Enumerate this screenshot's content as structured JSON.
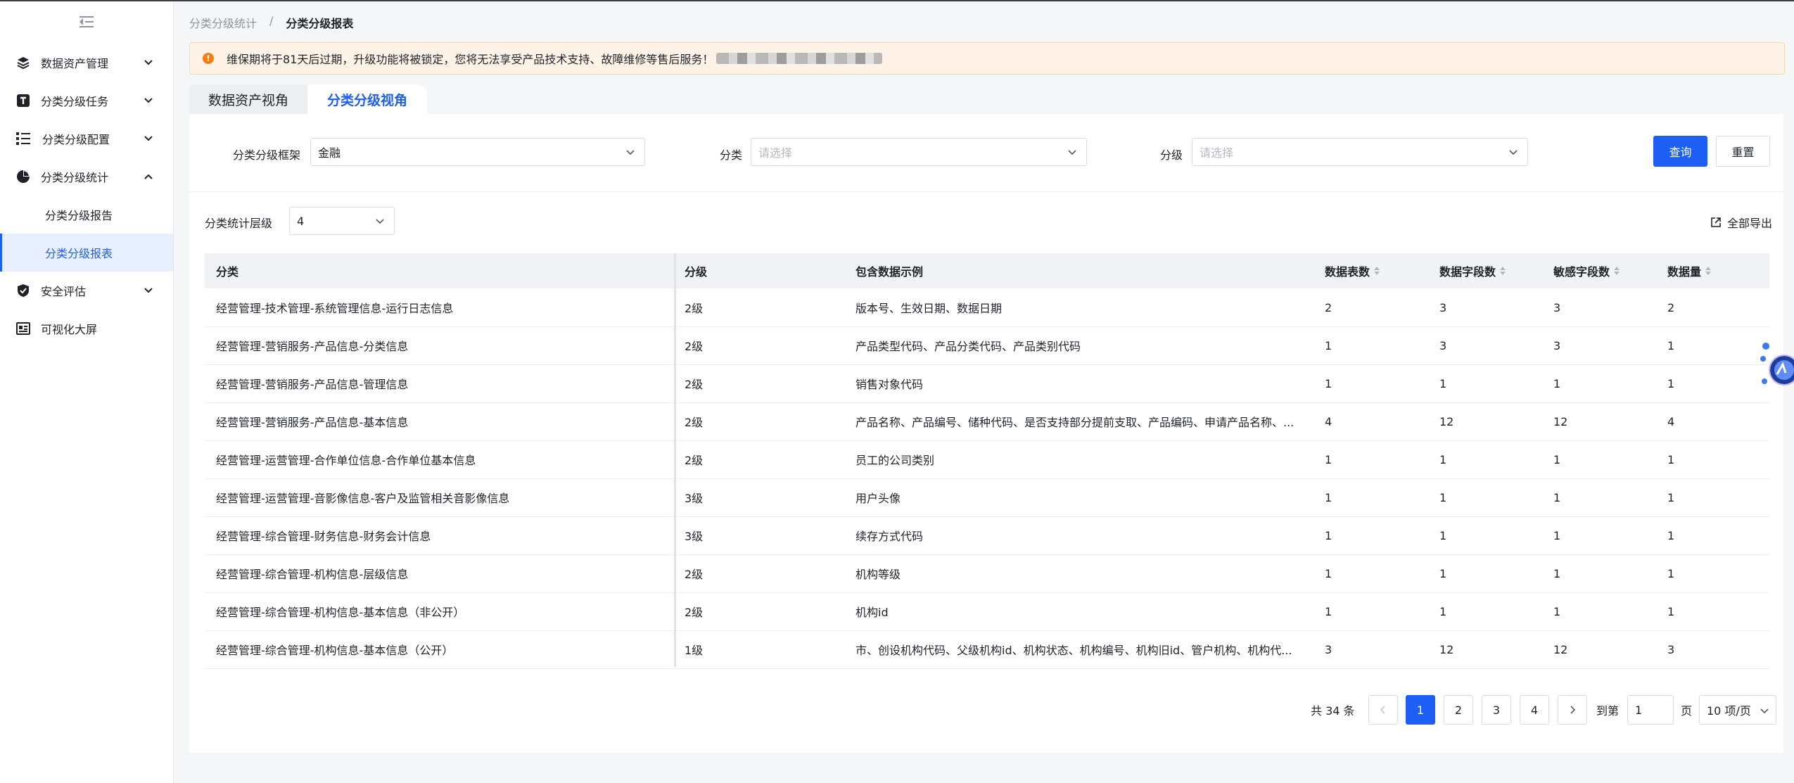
{
  "sidebar": {
    "items": [
      {
        "label": "数据资产管理",
        "icon": "layers-icon"
      },
      {
        "label": "分类分级任务",
        "icon": "task-icon"
      },
      {
        "label": "分类分级配置",
        "icon": "list-config-icon"
      },
      {
        "label": "分类分级统计",
        "icon": "pie-chart-icon"
      },
      {
        "label": "安全评估",
        "icon": "shield-check-icon"
      },
      {
        "label": "可视化大屏",
        "icon": "dashboard-icon"
      }
    ],
    "subitems": [
      {
        "label": "分类分级报告"
      },
      {
        "label": "分类分级报表"
      }
    ]
  },
  "breadcrumb": {
    "parent": "分类分级统计",
    "separator": "/",
    "current": "分类分级报表"
  },
  "alert": {
    "message": "维保期将于81天后过期，升级功能将被锁定，您将无法享受产品技术支持、故障维修等售后服务！"
  },
  "tabs": [
    {
      "label": "数据资产视角"
    },
    {
      "label": "分类分级视角"
    }
  ],
  "filters": {
    "framework_label": "分类分级框架",
    "framework_value": "金融",
    "category_label": "分类",
    "category_placeholder": "请选择",
    "level_label": "分级",
    "level_placeholder": "请选择",
    "query_button": "查询",
    "reset_button": "重置"
  },
  "stat_level": {
    "label": "分类统计层级",
    "value": "4"
  },
  "export_label": "全部导出",
  "table": {
    "columns": [
      "分类",
      "分级",
      "包含数据示例",
      "数据表数",
      "数据字段数",
      "敏感字段数",
      "数据量"
    ],
    "rows": [
      [
        "经营管理-技术管理-系统管理信息-运行日志信息",
        "2级",
        "版本号、生效日期、数据日期",
        "2",
        "3",
        "3",
        "2"
      ],
      [
        "经营管理-营销服务-产品信息-分类信息",
        "2级",
        "产品类型代码、产品分类代码、产品类别代码",
        "1",
        "3",
        "3",
        "1"
      ],
      [
        "经营管理-营销服务-产品信息-管理信息",
        "2级",
        "销售对象代码",
        "1",
        "1",
        "1",
        "1"
      ],
      [
        "经营管理-营销服务-产品信息-基本信息",
        "2级",
        "产品名称、产品编号、储种代码、是否支持部分提前支取、产品编码、申请产品名称、...",
        "4",
        "12",
        "12",
        "4"
      ],
      [
        "经营管理-运营管理-合作单位信息-合作单位基本信息",
        "2级",
        "员工的公司类别",
        "1",
        "1",
        "1",
        "1"
      ],
      [
        "经营管理-运营管理-音影像信息-客户及监管相关音影像信息",
        "3级",
        "用户头像",
        "1",
        "1",
        "1",
        "1"
      ],
      [
        "经营管理-综合管理-财务信息-财务会计信息",
        "3级",
        "续存方式代码",
        "1",
        "1",
        "1",
        "1"
      ],
      [
        "经营管理-综合管理-机构信息-层级信息",
        "2级",
        "机构等级",
        "1",
        "1",
        "1",
        "1"
      ],
      [
        "经营管理-综合管理-机构信息-基本信息（非公开）",
        "2级",
        "机构id",
        "1",
        "1",
        "1",
        "1"
      ],
      [
        "经营管理-综合管理-机构信息-基本信息（公开）",
        "1级",
        "市、创设机构代码、父级机构id、机构状态、机构编号、机构旧id、管户机构、机构代...",
        "3",
        "12",
        "12",
        "3"
      ]
    ]
  },
  "pagination": {
    "total": "共 34 条",
    "pages": [
      "1",
      "2",
      "3",
      "4"
    ],
    "current": "1",
    "goto_label": "到第",
    "goto_value": "1",
    "page_suffix": "页",
    "page_size": "10 项/页"
  },
  "colors": {
    "primary": "#1d5ef5",
    "alert_bg": "#fef3e6",
    "alert_icon": "#fa7d10"
  }
}
